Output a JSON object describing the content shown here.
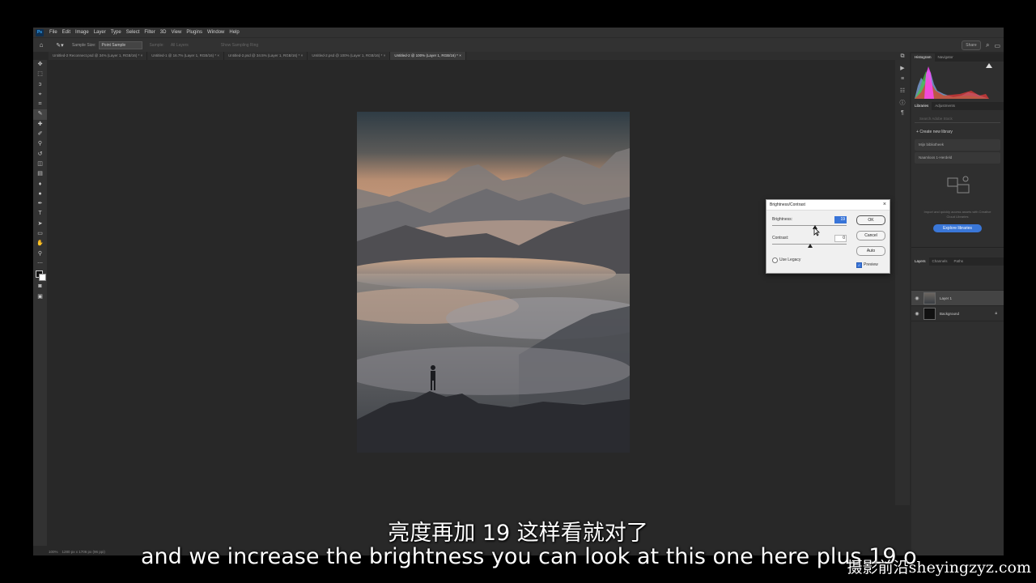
{
  "app": {
    "logo": "Ps"
  },
  "menu": [
    "File",
    "Edit",
    "Image",
    "Layer",
    "Type",
    "Select",
    "Filter",
    "3D",
    "View",
    "Plugins",
    "Window",
    "Help"
  ],
  "options_bar": {
    "sample_size_label": "Sample Size:",
    "sample_size_value": "Point Sample",
    "sample_label": "Sample:",
    "sample_value": "All Layers",
    "show_ring": "Show Sampling Ring",
    "share_label": "Share"
  },
  "tabs": [
    "Untitled-2 Reconnect.psd @ 34% (Layer 1, RGB/16) *",
    "Untitled-1 @ 16.7% (Layer 1, RGB/16) *",
    "Untitled-2.psd @ 34.5% (Layer 1, RGB/16) *",
    "Untitled-2.psd @ 100% (Layer 1, RGB/16) *",
    "Untitled-2 @ 100% (Layer 1, RGB/16) *"
  ],
  "active_tab_index": 4,
  "panels": {
    "top_tabs": [
      "Histogram",
      "Navigator"
    ],
    "lib_tabs": [
      "Libraries",
      "Adjustments"
    ],
    "lib_search_placeholder": "Search Adobe Stock",
    "create_library": "Create new library",
    "libraries": [
      "Mijn bibliotheek",
      "Naamloos 1-Herdeld"
    ],
    "lib_empty_text": "Import and quickly access assets with Creative Cloud Libraries",
    "explore_button": "Explore libraries",
    "layer_tabs": [
      "Layers",
      "Channels",
      "Paths"
    ],
    "layers": [
      {
        "name": "Layer 1",
        "selected": true,
        "locked": false
      },
      {
        "name": "Background",
        "selected": false,
        "locked": true
      }
    ]
  },
  "dialog": {
    "title": "Brightness/Contrast",
    "brightness_label": "Brightness:",
    "brightness_value": "19",
    "contrast_label": "Contrast:",
    "contrast_value": "0",
    "ok": "OK",
    "cancel": "Cancel",
    "auto": "Auto",
    "use_legacy": "Use Legacy",
    "preview": "Preview",
    "preview_checked": true,
    "use_legacy_checked": false
  },
  "status_bar": {
    "zoom": "100%",
    "doc_info": "1280 px x 1706 px (96 ppi)"
  },
  "subtitle": {
    "chinese": "亮度再加 19 这样看就对了",
    "english": "and we increase the brightness you can look at this one here plus 19 o"
  },
  "watermark": "摄影前沿sheyingzyz.com"
}
